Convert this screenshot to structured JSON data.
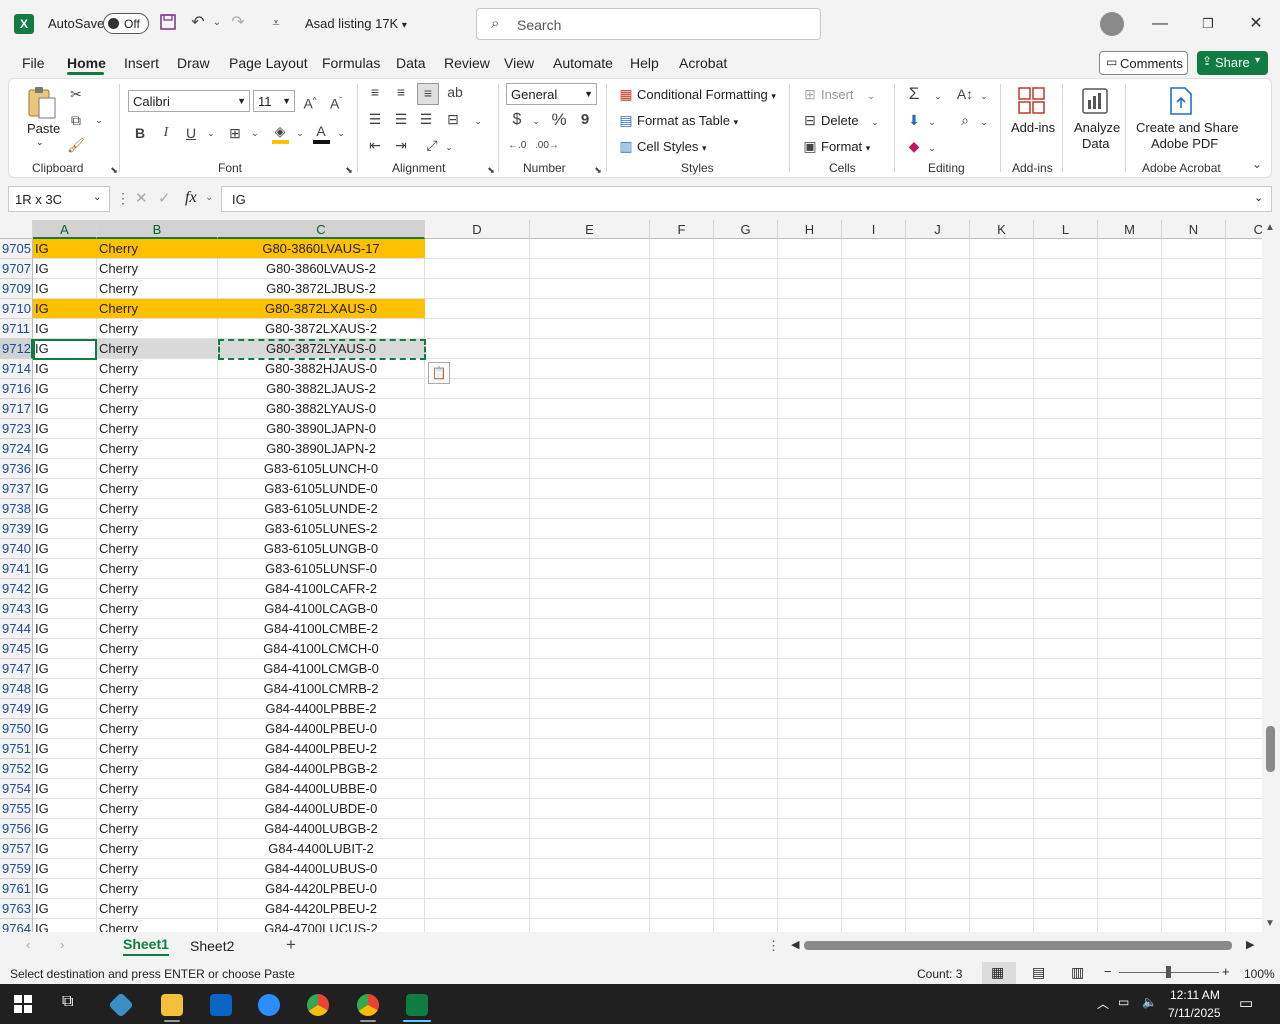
{
  "titlebar": {
    "app_logo": "X",
    "autosave_label": "AutoSave",
    "autosave_state": "Off",
    "doc_title": "Asad listing 17K",
    "search_placeholder": "Search",
    "icons": [
      "save-icon",
      "undo-icon",
      "redo-icon",
      "customize-icon",
      "user-avatar",
      "minimize-icon",
      "restore-icon",
      "close-icon"
    ]
  },
  "menu": {
    "tabs": [
      "File",
      "Home",
      "Insert",
      "Draw",
      "Page Layout",
      "Formulas",
      "Data",
      "Review",
      "View",
      "Automate",
      "Help",
      "Acrobat"
    ],
    "active": "Home",
    "comments_label": "Comments",
    "share_label": "Share"
  },
  "ribbon": {
    "clipboard": {
      "paste": "Paste",
      "label": "Clipboard"
    },
    "font": {
      "name": "Calibri",
      "size": "11",
      "bold": "B",
      "italic": "I",
      "underline": "U",
      "label": "Font"
    },
    "alignment": {
      "label": "Alignment"
    },
    "number": {
      "format": "General",
      "currency": "$",
      "percent": "%",
      "comma": "9",
      "label": "Number"
    },
    "styles": {
      "conditional": "Conditional Formatting",
      "format_table": "Format as Table",
      "cell_styles": "Cell Styles",
      "label": "Styles"
    },
    "cells": {
      "insert": "Insert",
      "delete": "Delete",
      "format": "Format",
      "label": "Cells"
    },
    "editing": {
      "label": "Editing"
    },
    "addins": {
      "addins": "Add-ins",
      "label": "Add-ins"
    },
    "analyze": {
      "line1": "Analyze",
      "line2": "Data"
    },
    "acrobat": {
      "line1": "Create and Share",
      "line2": "Adobe PDF",
      "label": "Adobe Acrobat"
    }
  },
  "formula_bar": {
    "name_box": "1R x 3C",
    "fx": "fx",
    "content": "IG"
  },
  "grid": {
    "columns": [
      "A",
      "B",
      "C",
      "D",
      "E",
      "F",
      "G",
      "H",
      "I",
      "J",
      "K",
      "L",
      "M",
      "N",
      "C"
    ],
    "rows": [
      {
        "num": "9705",
        "a": "IG",
        "b": "Cherry",
        "c": "G80-3860LVAUS-17",
        "hl": true
      },
      {
        "num": "9707",
        "a": "IG",
        "b": "Cherry",
        "c": "G80-3860LVAUS-2"
      },
      {
        "num": "9709",
        "a": "IG",
        "b": "Cherry",
        "c": "G80-3872LJBUS-2"
      },
      {
        "num": "9710",
        "a": "IG",
        "b": "Cherry",
        "c": "G80-3872LXAUS-0",
        "hl": true
      },
      {
        "num": "9711",
        "a": "IG",
        "b": "Cherry",
        "c": "G80-3872LXAUS-2"
      },
      {
        "num": "9712",
        "a": "IG",
        "b": "Cherry",
        "c": "G80-3872LYAUS-0",
        "cur": true
      },
      {
        "num": "9714",
        "a": "IG",
        "b": "Cherry",
        "c": "G80-3882HJAUS-0"
      },
      {
        "num": "9716",
        "a": "IG",
        "b": "Cherry",
        "c": "G80-3882LJAUS-2"
      },
      {
        "num": "9717",
        "a": "IG",
        "b": "Cherry",
        "c": "G80-3882LYAUS-0"
      },
      {
        "num": "9723",
        "a": "IG",
        "b": "Cherry",
        "c": "G80-3890LJAPN-0"
      },
      {
        "num": "9724",
        "a": "IG",
        "b": "Cherry",
        "c": "G80-3890LJAPN-2"
      },
      {
        "num": "9736",
        "a": "IG",
        "b": "Cherry",
        "c": "G83-6105LUNCH-0"
      },
      {
        "num": "9737",
        "a": "IG",
        "b": "Cherry",
        "c": "G83-6105LUNDE-0"
      },
      {
        "num": "9738",
        "a": "IG",
        "b": "Cherry",
        "c": "G83-6105LUNDE-2"
      },
      {
        "num": "9739",
        "a": "IG",
        "b": "Cherry",
        "c": "G83-6105LUNES-2"
      },
      {
        "num": "9740",
        "a": "IG",
        "b": "Cherry",
        "c": "G83-6105LUNGB-0"
      },
      {
        "num": "9741",
        "a": "IG",
        "b": "Cherry",
        "c": "G83-6105LUNSF-0"
      },
      {
        "num": "9742",
        "a": "IG",
        "b": "Cherry",
        "c": "G84-4100LCAFR-2"
      },
      {
        "num": "9743",
        "a": "IG",
        "b": "Cherry",
        "c": "G84-4100LCAGB-0"
      },
      {
        "num": "9744",
        "a": "IG",
        "b": "Cherry",
        "c": "G84-4100LCMBE-2"
      },
      {
        "num": "9745",
        "a": "IG",
        "b": "Cherry",
        "c": "G84-4100LCMCH-0"
      },
      {
        "num": "9747",
        "a": "IG",
        "b": "Cherry",
        "c": "G84-4100LCMGB-0"
      },
      {
        "num": "9748",
        "a": "IG",
        "b": "Cherry",
        "c": "G84-4100LCMRB-2"
      },
      {
        "num": "9749",
        "a": "IG",
        "b": "Cherry",
        "c": "G84-4400LPBBE-2"
      },
      {
        "num": "9750",
        "a": "IG",
        "b": "Cherry",
        "c": "G84-4400LPBEU-0"
      },
      {
        "num": "9751",
        "a": "IG",
        "b": "Cherry",
        "c": "G84-4400LPBEU-2"
      },
      {
        "num": "9752",
        "a": "IG",
        "b": "Cherry",
        "c": "G84-4400LPBGB-2"
      },
      {
        "num": "9754",
        "a": "IG",
        "b": "Cherry",
        "c": "G84-4400LUBBE-0"
      },
      {
        "num": "9755",
        "a": "IG",
        "b": "Cherry",
        "c": "G84-4400LUBDE-0"
      },
      {
        "num": "9756",
        "a": "IG",
        "b": "Cherry",
        "c": "G84-4400LUBGB-2"
      },
      {
        "num": "9757",
        "a": "IG",
        "b": "Cherry",
        "c": "G84-4400LUBIT-2"
      },
      {
        "num": "9759",
        "a": "IG",
        "b": "Cherry",
        "c": "G84-4400LUBUS-0"
      },
      {
        "num": "9761",
        "a": "IG",
        "b": "Cherry",
        "c": "G84-4420LPBEU-0"
      },
      {
        "num": "9763",
        "a": "IG",
        "b": "Cherry",
        "c": "G84-4420LPBEU-2"
      },
      {
        "num": "9764",
        "a": "IG",
        "b": "Cherry",
        "c": "G84-4700LUCUS-2"
      }
    ],
    "highlight_color": "#ffc000"
  },
  "sheets": {
    "tabs": [
      "Sheet1",
      "Sheet2"
    ],
    "active": "Sheet1"
  },
  "status": {
    "message": "Select destination and press ENTER or choose Paste",
    "count": "Count: 3",
    "zoom": "100%"
  },
  "taskbar": {
    "time": "12:11 AM",
    "date": "7/11/2025"
  }
}
